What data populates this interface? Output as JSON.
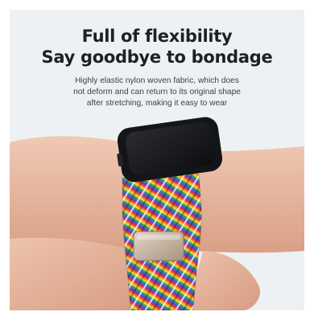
{
  "headline": {
    "line1": "Full of flexibility",
    "line2": "Say goodbye to bondage"
  },
  "description": {
    "line1": "Highly elastic nylon woven fabric, which does",
    "line2": "not deform and can return to its original shape",
    "line3": "after stretching, making it easy to wear"
  },
  "colors": {
    "background": "#eef1f3",
    "headline": "#1e2024",
    "skin": "#e7b8a0",
    "watch_case": "#141518",
    "buckle": "#c9b8a4"
  },
  "image": {
    "subject": "watch-on-wrist-with-rainbow-braided-band"
  }
}
